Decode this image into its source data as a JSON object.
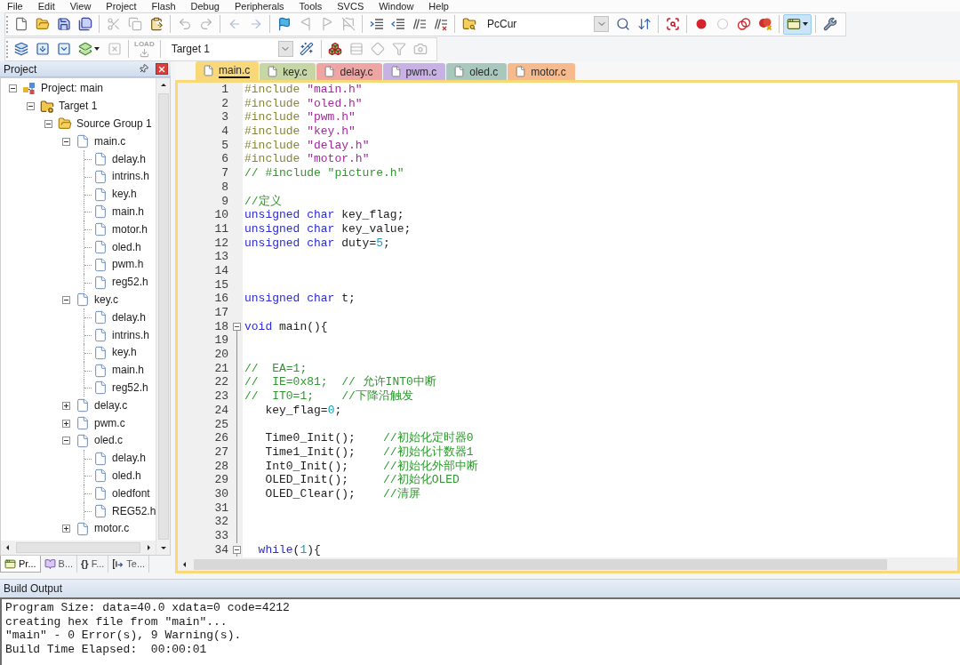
{
  "menu": [
    "File",
    "Edit",
    "View",
    "Project",
    "Flash",
    "Debug",
    "Peripherals",
    "Tools",
    "SVCS",
    "Window",
    "Help"
  ],
  "toolbar_1": {
    "items": [
      {
        "kind": "button",
        "disabled": false,
        "active": false
      },
      {
        "kind": "button",
        "disabled": false,
        "active": false
      },
      {
        "kind": "button",
        "disabled": false,
        "active": false
      },
      {
        "kind": "button",
        "disabled": false,
        "active": false
      },
      {
        "kind": "separator"
      },
      {
        "kind": "button",
        "disabled": true,
        "active": false
      },
      {
        "kind": "button",
        "disabled": true,
        "active": false
      },
      {
        "kind": "button",
        "disabled": false,
        "active": false
      },
      {
        "kind": "separator"
      },
      {
        "kind": "button",
        "disabled": true,
        "active": false
      },
      {
        "kind": "button",
        "disabled": true,
        "active": false
      },
      {
        "kind": "separator"
      },
      {
        "kind": "button",
        "disabled": true,
        "active": false
      },
      {
        "kind": "button",
        "disabled": true,
        "active": false
      },
      {
        "kind": "separator"
      },
      {
        "kind": "button",
        "disabled": false,
        "active": false
      },
      {
        "kind": "button",
        "disabled": true,
        "active": false
      },
      {
        "kind": "button",
        "disabled": true,
        "active": false
      },
      {
        "kind": "button",
        "disabled": true,
        "active": false
      },
      {
        "kind": "separator"
      },
      {
        "kind": "button",
        "disabled": false,
        "active": false
      },
      {
        "kind": "button",
        "disabled": false,
        "active": false
      },
      {
        "kind": "button",
        "disabled": false,
        "active": false
      },
      {
        "kind": "button",
        "disabled": false,
        "active": false
      },
      {
        "kind": "separator"
      },
      {
        "kind": "button",
        "disabled": false,
        "active": false
      },
      {
        "kind": "combo",
        "value": "PcCur"
      },
      {
        "kind": "button",
        "disabled": false,
        "active": false
      },
      {
        "kind": "button",
        "disabled": false,
        "active": false
      },
      {
        "kind": "separator"
      },
      {
        "kind": "button",
        "disabled": false,
        "active": false
      },
      {
        "kind": "separator"
      },
      {
        "kind": "button",
        "disabled": false,
        "active": false
      },
      {
        "kind": "button",
        "disabled": true,
        "active": false
      },
      {
        "kind": "button",
        "disabled": false,
        "active": false
      },
      {
        "kind": "button",
        "disabled": false,
        "active": false
      },
      {
        "kind": "separator"
      },
      {
        "kind": "split-button",
        "disabled": false,
        "active": true
      },
      {
        "kind": "separator"
      },
      {
        "kind": "button",
        "disabled": false,
        "active": false
      }
    ]
  },
  "toolbar_2": {
    "items": [
      {
        "kind": "button",
        "disabled": false,
        "active": false
      },
      {
        "kind": "button",
        "disabled": false,
        "active": false
      },
      {
        "kind": "button",
        "disabled": false,
        "active": false
      },
      {
        "kind": "split-button",
        "disabled": false,
        "active": false
      },
      {
        "kind": "button",
        "disabled": true,
        "active": false
      },
      {
        "kind": "separator"
      },
      {
        "kind": "button",
        "disabled": true,
        "active": false,
        "badge": "LOAD"
      },
      {
        "kind": "separator"
      },
      {
        "kind": "combo",
        "value": "Target 1"
      },
      {
        "kind": "button",
        "disabled": false,
        "active": false
      },
      {
        "kind": "separator"
      },
      {
        "kind": "button",
        "disabled": false,
        "active": false
      },
      {
        "kind": "button",
        "disabled": true,
        "active": false
      },
      {
        "kind": "button",
        "disabled": true,
        "active": false
      },
      {
        "kind": "button",
        "disabled": true,
        "active": false
      },
      {
        "kind": "button",
        "disabled": true,
        "active": false
      }
    ]
  },
  "project_panel": {
    "title": "Project",
    "tree": [
      {
        "label": "Project: main",
        "kind": "project",
        "expanded": true,
        "children": [
          {
            "label": "Target 1",
            "kind": "target",
            "expanded": true,
            "children": [
              {
                "label": "Source Group 1",
                "kind": "group",
                "expanded": true,
                "children": [
                  {
                    "label": "main.c",
                    "kind": "source",
                    "expanded": true,
                    "children": [
                      {
                        "label": "delay.h",
                        "kind": "header"
                      },
                      {
                        "label": "intrins.h",
                        "kind": "header"
                      },
                      {
                        "label": "key.h",
                        "kind": "header"
                      },
                      {
                        "label": "main.h",
                        "kind": "header"
                      },
                      {
                        "label": "motor.h",
                        "kind": "header"
                      },
                      {
                        "label": "oled.h",
                        "kind": "header"
                      },
                      {
                        "label": "pwm.h",
                        "kind": "header"
                      },
                      {
                        "label": "reg52.h",
                        "kind": "header"
                      }
                    ]
                  },
                  {
                    "label": "key.c",
                    "kind": "source",
                    "expanded": true,
                    "children": [
                      {
                        "label": "delay.h",
                        "kind": "header"
                      },
                      {
                        "label": "intrins.h",
                        "kind": "header"
                      },
                      {
                        "label": "key.h",
                        "kind": "header"
                      },
                      {
                        "label": "main.h",
                        "kind": "header"
                      },
                      {
                        "label": "reg52.h",
                        "kind": "header"
                      }
                    ]
                  },
                  {
                    "label": "delay.c",
                    "kind": "source",
                    "expanded": false
                  },
                  {
                    "label": "pwm.c",
                    "kind": "source",
                    "expanded": false
                  },
                  {
                    "label": "oled.c",
                    "kind": "source",
                    "expanded": true,
                    "children": [
                      {
                        "label": "delay.h",
                        "kind": "header"
                      },
                      {
                        "label": "oled.h",
                        "kind": "header"
                      },
                      {
                        "label": "oledfont",
                        "kind": "header"
                      },
                      {
                        "label": "REG52.h",
                        "kind": "header"
                      }
                    ]
                  },
                  {
                    "label": "motor.c",
                    "kind": "source",
                    "expanded": false
                  }
                ]
              }
            ]
          }
        ]
      }
    ],
    "tabs": [
      {
        "kind": "project",
        "label": "Pr...",
        "selected": true
      },
      {
        "kind": "books",
        "label": "B...",
        "selected": false
      },
      {
        "kind": "functions",
        "glyph": "{}",
        "label": "F...",
        "selected": false
      },
      {
        "kind": "templates",
        "label": "Te...",
        "selected": false
      }
    ]
  },
  "editor": {
    "tabs": [
      {
        "label": "main.c",
        "selected": true,
        "color": "#f8d878"
      },
      {
        "label": "key.c",
        "selected": false,
        "color": "#c6d6a5"
      },
      {
        "label": "delay.c",
        "selected": false,
        "color": "#f0a5a5"
      },
      {
        "label": "pwm.c",
        "selected": false,
        "color": "#c8b2e5"
      },
      {
        "label": "oled.c",
        "selected": false,
        "color": "#a8c8bd"
      },
      {
        "label": "motor.c",
        "selected": false,
        "color": "#f6ba8c"
      }
    ],
    "lines": [
      {
        "number": "1",
        "kind": "plain",
        "tokens": [
          {
            "kind": "preprocessor",
            "text": "#include "
          },
          {
            "kind": "string",
            "text": "\"main.h\""
          }
        ]
      },
      {
        "number": "2",
        "kind": "plain",
        "tokens": [
          {
            "kind": "preprocessor",
            "text": "#include "
          },
          {
            "kind": "string",
            "text": "\"oled.h\""
          }
        ]
      },
      {
        "number": "3",
        "kind": "plain",
        "tokens": [
          {
            "kind": "preprocessor",
            "text": "#include "
          },
          {
            "kind": "string",
            "text": "\"pwm.h\""
          }
        ]
      },
      {
        "number": "4",
        "kind": "plain",
        "tokens": [
          {
            "kind": "preprocessor",
            "text": "#include "
          },
          {
            "kind": "string",
            "text": "\"key.h\""
          }
        ]
      },
      {
        "number": "5",
        "kind": "plain",
        "tokens": [
          {
            "kind": "preprocessor",
            "text": "#include "
          },
          {
            "kind": "string",
            "text": "\"delay.h\""
          }
        ]
      },
      {
        "number": "6",
        "kind": "plain",
        "tokens": [
          {
            "kind": "preprocessor",
            "text": "#include "
          },
          {
            "kind": "string",
            "text": "\"motor.h\""
          }
        ]
      },
      {
        "number": "7",
        "kind": "plain",
        "tokens": [
          {
            "kind": "comment",
            "text": "// #include \"picture.h\""
          }
        ]
      },
      {
        "number": "8",
        "kind": "plain"
      },
      {
        "number": "9",
        "kind": "plain",
        "tokens": [
          {
            "kind": "comment",
            "text": "//定义"
          }
        ]
      },
      {
        "number": "10",
        "kind": "plain",
        "tokens": [
          {
            "kind": "keyword",
            "text": "unsigned char "
          },
          {
            "kind": "plain",
            "text": "key_flag;"
          }
        ]
      },
      {
        "number": "11",
        "kind": "plain",
        "tokens": [
          {
            "kind": "keyword",
            "text": "unsigned char "
          },
          {
            "kind": "plain",
            "text": "key_value;"
          }
        ]
      },
      {
        "number": "12",
        "kind": "plain",
        "tokens": [
          {
            "kind": "keyword",
            "text": "unsigned char "
          },
          {
            "kind": "plain",
            "text": "duty="
          },
          {
            "kind": "number",
            "text": "5"
          },
          {
            "kind": "plain",
            "text": ";"
          }
        ]
      },
      {
        "number": "13",
        "kind": "plain"
      },
      {
        "number": "14",
        "kind": "plain"
      },
      {
        "number": "15",
        "kind": "plain"
      },
      {
        "number": "16",
        "kind": "plain",
        "tokens": [
          {
            "kind": "keyword",
            "text": "unsigned char "
          },
          {
            "kind": "plain",
            "text": "t;"
          }
        ]
      },
      {
        "number": "17",
        "kind": "plain"
      },
      {
        "number": "18",
        "kind": "fold-start",
        "tokens": [
          {
            "kind": "keyword",
            "text": "void "
          },
          {
            "kind": "plain",
            "text": "main(){"
          }
        ]
      },
      {
        "number": "19",
        "kind": "fold-body"
      },
      {
        "number": "20",
        "kind": "fold-body"
      },
      {
        "number": "21",
        "kind": "fold-body",
        "tokens": [
          {
            "kind": "comment",
            "text": "//  EA=1;"
          }
        ]
      },
      {
        "number": "22",
        "kind": "fold-body",
        "tokens": [
          {
            "kind": "comment",
            "text": "//  IE=0x81;  // 允许INT0中断"
          }
        ]
      },
      {
        "number": "23",
        "kind": "fold-body",
        "tokens": [
          {
            "kind": "comment",
            "text": "//  IT0=1;    //下降沿触发"
          }
        ]
      },
      {
        "number": "24",
        "kind": "fold-body",
        "tokens": [
          {
            "kind": "plain",
            "text": "   key_flag="
          },
          {
            "kind": "number",
            "text": "0"
          },
          {
            "kind": "plain",
            "text": ";"
          }
        ]
      },
      {
        "number": "25",
        "kind": "fold-body"
      },
      {
        "number": "26",
        "kind": "fold-body",
        "tokens": [
          {
            "kind": "plain",
            "text": "   Time0_Init();    "
          },
          {
            "kind": "comment",
            "text": "//初始化定时器0"
          }
        ]
      },
      {
        "number": "27",
        "kind": "fold-body",
        "tokens": [
          {
            "kind": "plain",
            "text": "   Time1_Init();    "
          },
          {
            "kind": "comment",
            "text": "//初始化计数器1"
          }
        ]
      },
      {
        "number": "28",
        "kind": "fold-body",
        "tokens": [
          {
            "kind": "plain",
            "text": "   Int0_Init();     "
          },
          {
            "kind": "comment",
            "text": "//初始化外部中断"
          }
        ]
      },
      {
        "number": "29",
        "kind": "fold-body",
        "tokens": [
          {
            "kind": "plain",
            "text": "   OLED_Init();     "
          },
          {
            "kind": "comment",
            "text": "//初始化OLED"
          }
        ]
      },
      {
        "number": "30",
        "kind": "fold-body",
        "tokens": [
          {
            "kind": "plain",
            "text": "   OLED_Clear();    "
          },
          {
            "kind": "comment",
            "text": "//清屏"
          }
        ]
      },
      {
        "number": "31",
        "kind": "fold-body"
      },
      {
        "number": "32",
        "kind": "fold-body"
      },
      {
        "number": "33",
        "kind": "fold-body"
      },
      {
        "number": "34",
        "kind": "fold-start",
        "tokens": [
          {
            "kind": "keyword",
            "text": "  while"
          },
          {
            "kind": "plain",
            "text": "("
          },
          {
            "kind": "number",
            "text": "1"
          },
          {
            "kind": "plain",
            "text": "){"
          }
        ]
      }
    ]
  },
  "build_output": {
    "title": "Build Output",
    "lines": [
      "Program Size: data=40.0 xdata=0 code=4212",
      "creating hex file from \"main\"...",
      "\"main\" - 0 Error(s), 9 Warning(s).",
      "Build Time Elapsed:  00:00:01"
    ]
  }
}
